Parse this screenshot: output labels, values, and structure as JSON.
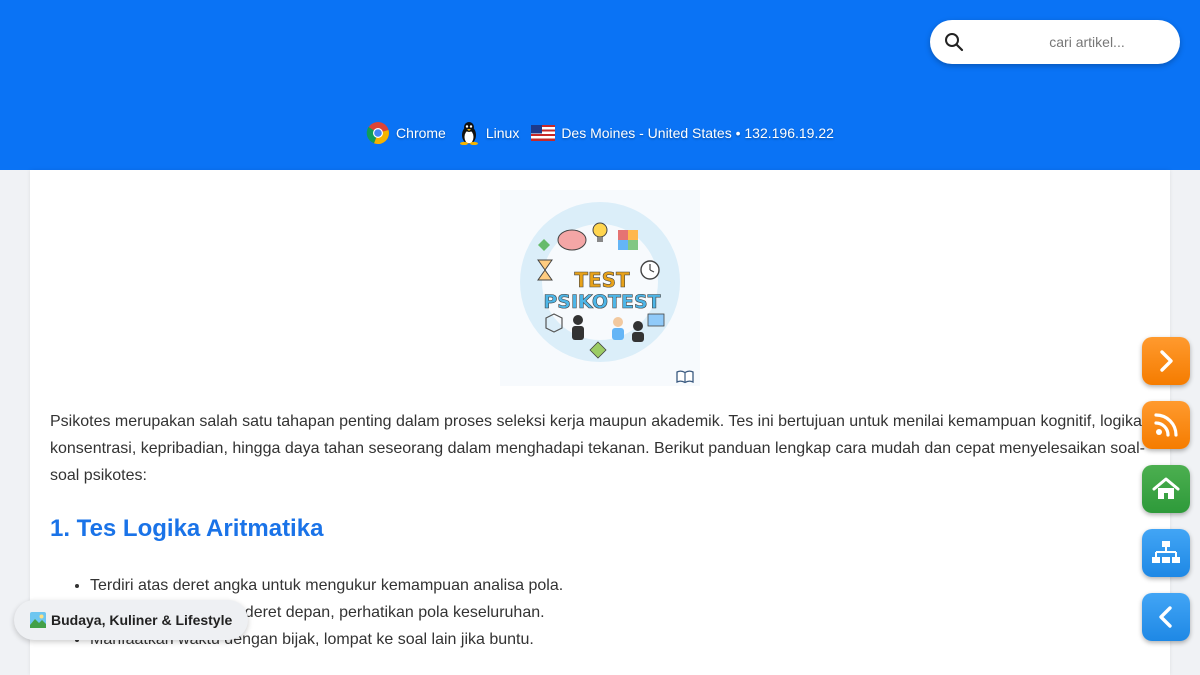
{
  "search": {
    "placeholder": "cari artikel..."
  },
  "environment": {
    "browser": "Chrome",
    "os": "Linux",
    "location": "Des Moines - United States • 132.196.19.22"
  },
  "hero": {
    "line1": "TEST",
    "line2": "PSIKOTEST"
  },
  "article": {
    "intro": "Psikotes merupakan salah satu tahapan penting dalam proses seleksi kerja maupun akademik. Tes ini bertujuan untuk menilai kemampuan kognitif, logika, konsentrasi, kepribadian, hingga daya tahan seseorang dalam menghadapi tekanan. Berikut panduan lengkap cara mudah dan cepat menyelesaikan soal-soal psikotes:",
    "section1_title": "1. Tes Logika Aritmatika",
    "section1_items": [
      "Terdiri atas deret angka untuk mengukur kemampuan analisa pola.",
      "Jangan terpaku pada deret depan, perhatikan pola keseluruhan.",
      "Manfaatkan waktu dengan bijak, lompat ke soal lain jika buntu."
    ]
  },
  "category_badge": {
    "label": "Budaya, Kuliner & Lifestyle"
  },
  "fab_buttons": [
    {
      "icon": "chevron-right-icon",
      "color": "#f57c00"
    },
    {
      "icon": "rss-icon",
      "color": "#f57c00"
    },
    {
      "icon": "home-icon",
      "color": "#2e9a3a"
    },
    {
      "icon": "sitemap-icon",
      "color": "#1e88e5"
    },
    {
      "icon": "chevron-left-icon",
      "color": "#1e88e5"
    }
  ],
  "colors": {
    "header": "#0a73f5",
    "heading": "#1a73e8"
  }
}
